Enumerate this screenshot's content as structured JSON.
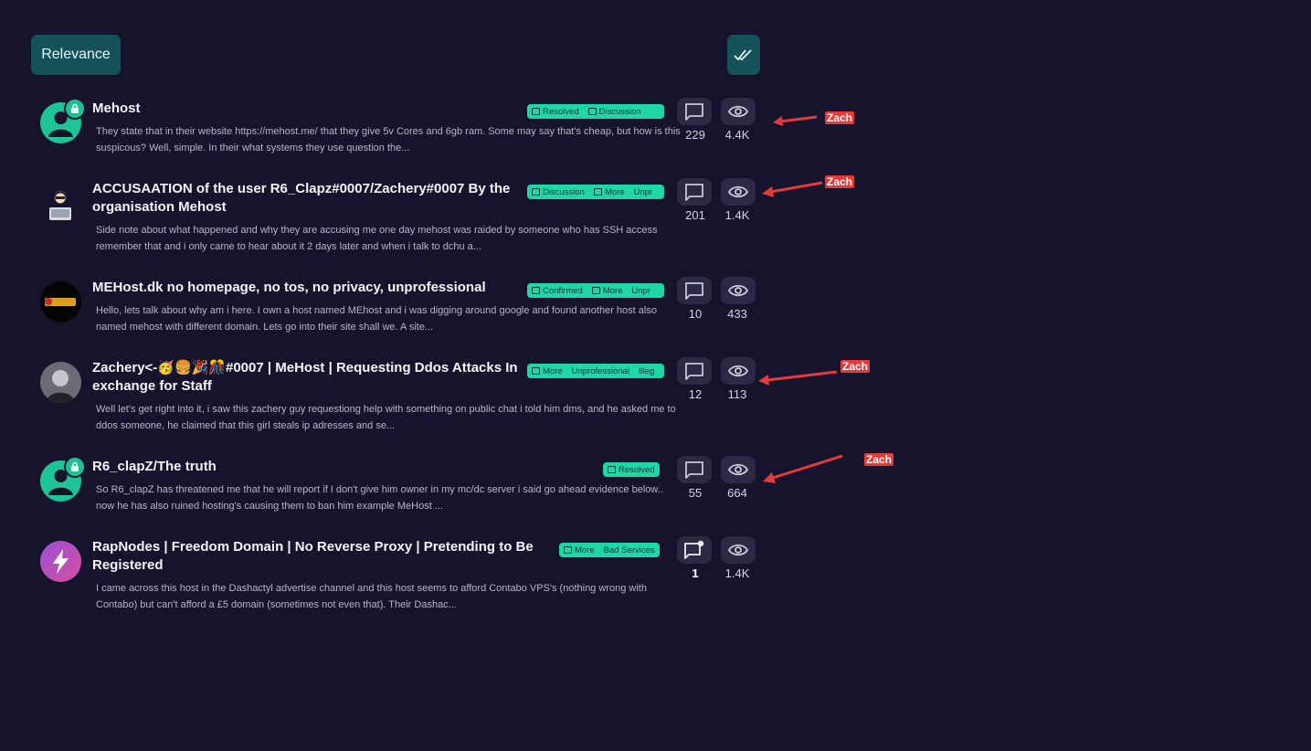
{
  "toolbar": {
    "sort_label": "Relevance",
    "mark_read_icon": "double-check-icon"
  },
  "threads": [
    {
      "title": "Mehost",
      "excerpt": "They state that in their website https://mehost.me/ that they give 5v Cores and 6gb ram. Some may say that's cheap, but how is this suspicous? Well, simple. In their what systems they use question the...",
      "tags": [
        "Resolved",
        "Discussion"
      ],
      "replies": "229",
      "views": "4.4K",
      "avatar": "default-user-avatar",
      "locked": true
    },
    {
      "title": "ACCUSAATION of the user R6_Clapz#0007/Zachery#0007 By the organisation Mehost",
      "excerpt": "Side note about what happened and why they are accusing me one day mehost was raided by someone who has SSH access remember that and i only came to hear about it 2 days later and when i talk to dchu a...",
      "tags": [
        "Discussion",
        "More",
        "Unpr"
      ],
      "replies": "201",
      "views": "1.4K",
      "avatar": "laptop-user-avatar",
      "locked": false
    },
    {
      "title": "MEHost.dk no homepage, no tos, no privacy, unprofessional",
      "excerpt": "Hello, lets talk about why am i here. I own a host named MEhost and i was digging around google and found another host also named mehost with different domain. Lets go into their site shall we. A site...",
      "tags": [
        "Confirmed",
        "More",
        "Unpr"
      ],
      "replies": "10",
      "views": "433",
      "avatar": "logo-avatar",
      "locked": false
    },
    {
      "title": "Zachery<-🥳🍔🎉🎊#0007 | MeHost | Requesting Ddos Attacks In exchange for Staff",
      "excerpt": "Well let's get right into it, i saw this zachery guy requestiong help with something on public chat i told him dms, and he asked me to ddos someone, he claimed that this girl steals ip adresses and se...",
      "tags": [
        "More",
        "Unprofessional",
        "Illeg"
      ],
      "replies": "12",
      "views": "113",
      "avatar": "hooded-user-avatar",
      "locked": false
    },
    {
      "title": "R6_clapZ/The truth",
      "excerpt": "So R6_clapZ has threatened me that he will report if I don't give him owner in my mc/dc server i said go ahead evidence below.. now he has also ruined hosting's causing them to ban him example MeHost ...",
      "tags": [
        "Resolved"
      ],
      "replies": "55",
      "views": "664",
      "avatar": "default-user-avatar",
      "locked": true
    },
    {
      "title": "RapNodes | Freedom Domain | No Reverse Proxy | Pretending to Be Registered",
      "excerpt": "I came across this host in the Dashactyl advertise channel and this host seems to afford Contabo VPS's (nothing wrong with Contabo) but can't afford a £5 domain (sometimes not even that). Their Dashac...",
      "tags": [
        "More",
        "Bad Services"
      ],
      "replies": "1",
      "views": "1.4K",
      "avatar": "lightning-avatar",
      "locked": false,
      "unread": true
    }
  ],
  "annotations": {
    "label": "Zach",
    "color": "#e23b3b"
  }
}
